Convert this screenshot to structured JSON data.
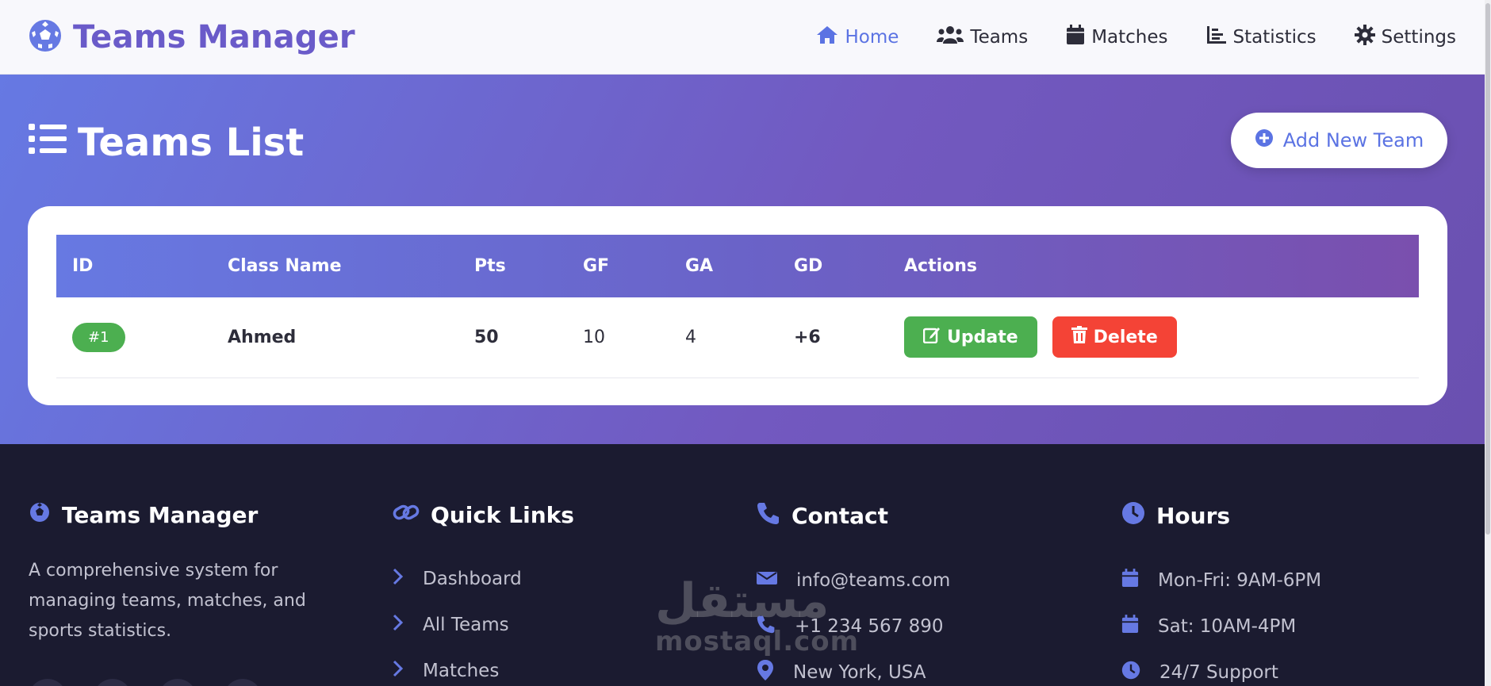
{
  "header": {
    "brand": "Teams Manager",
    "nav": [
      {
        "label": "Home",
        "icon": "home-icon",
        "active": true
      },
      {
        "label": "Teams",
        "icon": "users-icon",
        "active": false
      },
      {
        "label": "Matches",
        "icon": "calendar-icon",
        "active": false
      },
      {
        "label": "Statistics",
        "icon": "chart-icon",
        "active": false
      },
      {
        "label": "Settings",
        "icon": "gear-icon",
        "active": false
      }
    ]
  },
  "hero": {
    "title": "Teams List",
    "add_button": "Add New Team"
  },
  "table": {
    "columns": [
      "ID",
      "Class Name",
      "Pts",
      "GF",
      "GA",
      "GD",
      "Actions"
    ],
    "rows": [
      {
        "id": "#1",
        "name": "Ahmed",
        "pts": "50",
        "gf": "10",
        "ga": "4",
        "gd": "+6"
      }
    ],
    "update_label": "Update",
    "delete_label": "Delete"
  },
  "footer": {
    "about": {
      "title": "Teams Manager",
      "description": "A comprehensive system for managing teams, matches, and sports statistics."
    },
    "quick_links": {
      "title": "Quick Links",
      "items": [
        "Dashboard",
        "All Teams",
        "Matches"
      ]
    },
    "contact": {
      "title": "Contact",
      "items": [
        "info@teams.com",
        "+1 234 567 890",
        "New York, USA"
      ]
    },
    "hours": {
      "title": "Hours",
      "items": [
        "Mon-Fri: 9AM-6PM",
        "Sat: 10AM-4PM",
        "24/7 Support"
      ]
    }
  },
  "watermark": {
    "arabic": "مستقل",
    "latin": "mostaql.com"
  },
  "colors": {
    "accent": "#5b73e3",
    "brand": "#6a5bc9",
    "success": "#4caf50",
    "danger": "#f44336",
    "footer_bg": "#1b1b30"
  }
}
